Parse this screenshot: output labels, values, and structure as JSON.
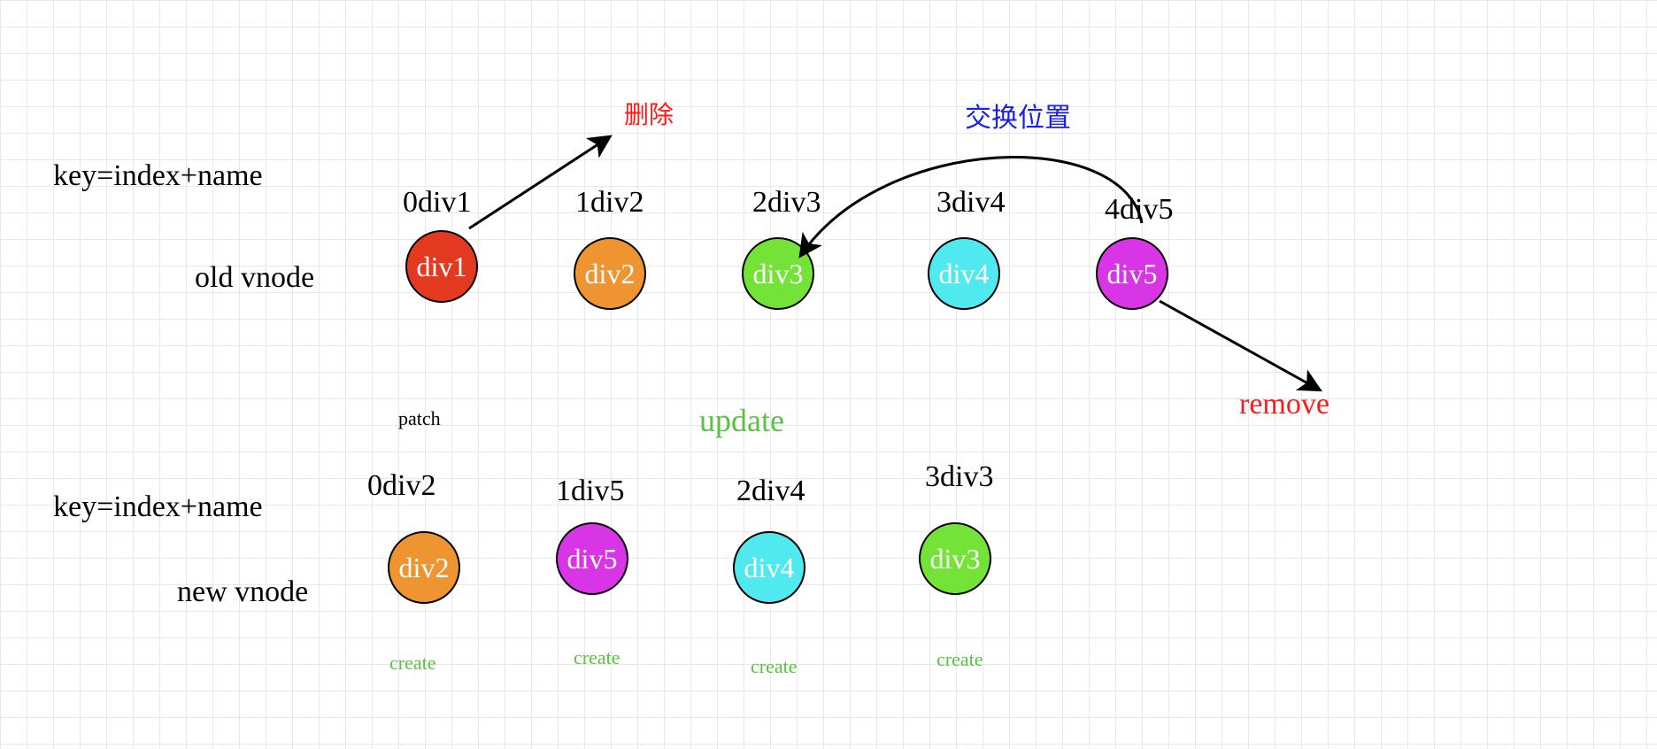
{
  "labels": {
    "key_formula_top": "key=index+name",
    "key_formula_bottom": "key=index+name",
    "old_vnode": "old vnode",
    "new_vnode": "new vnode",
    "delete": "删除",
    "swap": "交换位置",
    "patch": "patch",
    "update": "update",
    "remove": "remove"
  },
  "old_nodes": [
    {
      "key": "0div1",
      "text": "div1",
      "color": "#e33920"
    },
    {
      "key": "1div2",
      "text": "div2",
      "color": "#ee9430"
    },
    {
      "key": "2div3",
      "text": "div3",
      "color": "#73e337"
    },
    {
      "key": "3div4",
      "text": "div4",
      "color": "#51e9f0"
    },
    {
      "key": "4div5",
      "text": "div5",
      "color": "#d735e6"
    }
  ],
  "new_nodes": [
    {
      "key": "0div2",
      "text": "div2",
      "color": "#ee9430",
      "sub": "create"
    },
    {
      "key": "1div5",
      "text": "div5",
      "color": "#d735e6",
      "sub": "create"
    },
    {
      "key": "2div4",
      "text": "div4",
      "color": "#51e9f0",
      "sub": "create"
    },
    {
      "key": "3div3",
      "text": "div3",
      "color": "#73e337",
      "sub": "create"
    }
  ]
}
